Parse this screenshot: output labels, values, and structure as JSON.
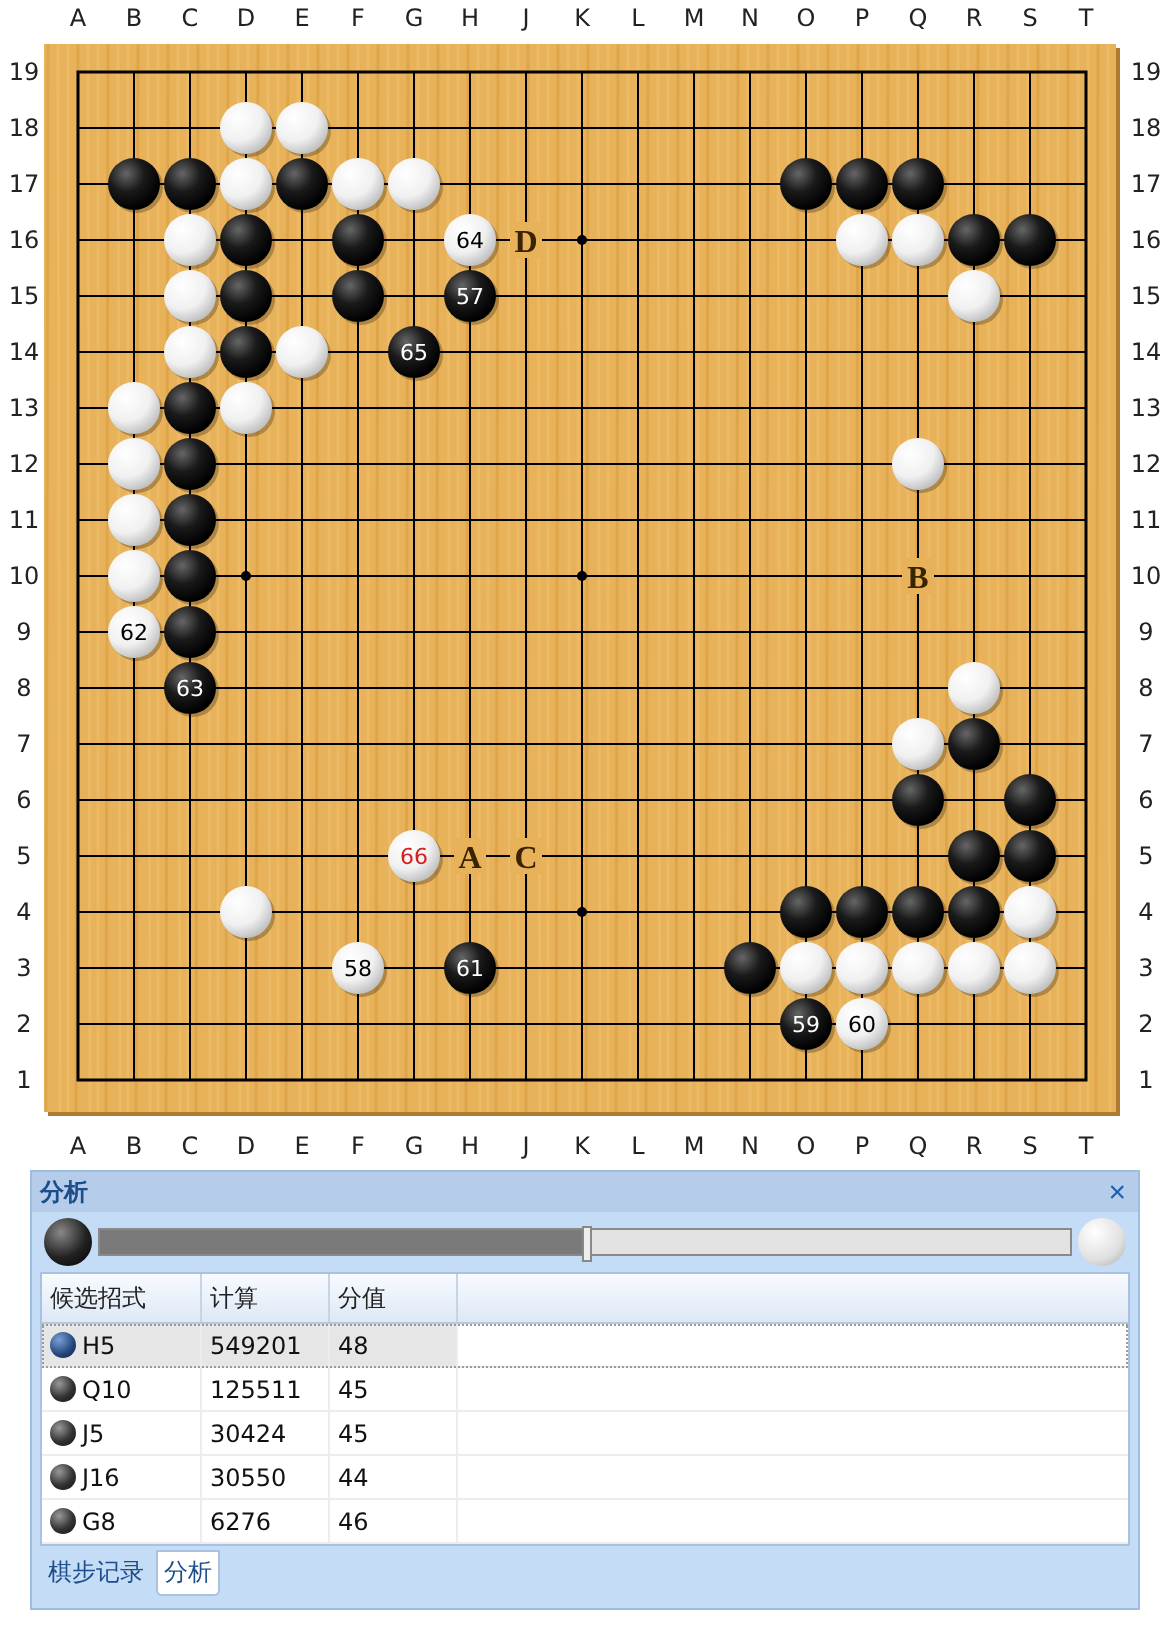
{
  "board": {
    "top_labels": [
      "A",
      "B",
      "C",
      "D",
      "E",
      "F",
      "G",
      "H",
      "J",
      "K",
      "L",
      "M",
      "N",
      "O",
      "P",
      "Q",
      "R",
      "S",
      "T"
    ],
    "bottom_labels": [
      "A",
      "B",
      "C",
      "D",
      "E",
      "F",
      "G",
      "H",
      "J",
      "K",
      "L",
      "M",
      "N",
      "O",
      "P",
      "Q",
      "R",
      "S",
      "T"
    ],
    "left_labels": [
      "19",
      "18",
      "17",
      "16",
      "15",
      "14",
      "13",
      "12",
      "11",
      "10",
      "9",
      "8",
      "7",
      "6",
      "5",
      "4",
      "3",
      "2",
      "1"
    ],
    "right_labels": [
      "19",
      "18",
      "17",
      "16",
      "15",
      "14",
      "13",
      "12",
      "11",
      "10",
      "9",
      "8",
      "7",
      "6",
      "5",
      "4",
      "3",
      "2",
      "1"
    ],
    "rows": [
      {
        "points": [
          {
            "kind": "empty"
          },
          {
            "kind": "empty"
          },
          {
            "kind": "empty"
          },
          {
            "kind": "empty"
          },
          {
            "kind": "empty"
          },
          {
            "kind": "empty"
          },
          {
            "kind": "empty"
          },
          {
            "kind": "empty"
          },
          {
            "kind": "empty"
          },
          {
            "kind": "empty"
          },
          {
            "kind": "empty"
          },
          {
            "kind": "empty"
          },
          {
            "kind": "empty"
          },
          {
            "kind": "empty"
          },
          {
            "kind": "empty"
          },
          {
            "kind": "empty"
          },
          {
            "kind": "empty"
          },
          {
            "kind": "empty"
          },
          {
            "kind": "empty"
          }
        ]
      },
      {
        "points": [
          {
            "kind": "empty"
          },
          {
            "kind": "empty"
          },
          {
            "kind": "empty"
          },
          {
            "kind": "white"
          },
          {
            "kind": "white"
          },
          {
            "kind": "empty"
          },
          {
            "kind": "empty"
          },
          {
            "kind": "empty"
          },
          {
            "kind": "empty"
          },
          {
            "kind": "empty"
          },
          {
            "kind": "empty"
          },
          {
            "kind": "empty"
          },
          {
            "kind": "empty"
          },
          {
            "kind": "empty"
          },
          {
            "kind": "empty"
          },
          {
            "kind": "empty"
          },
          {
            "kind": "empty"
          },
          {
            "kind": "empty"
          },
          {
            "kind": "empty"
          }
        ]
      },
      {
        "points": [
          {
            "kind": "empty"
          },
          {
            "kind": "black"
          },
          {
            "kind": "black"
          },
          {
            "kind": "white"
          },
          {
            "kind": "black"
          },
          {
            "kind": "white"
          },
          {
            "kind": "white"
          },
          {
            "kind": "empty"
          },
          {
            "kind": "empty"
          },
          {
            "kind": "empty"
          },
          {
            "kind": "empty"
          },
          {
            "kind": "empty"
          },
          {
            "kind": "empty"
          },
          {
            "kind": "black"
          },
          {
            "kind": "black"
          },
          {
            "kind": "black"
          },
          {
            "kind": "empty"
          },
          {
            "kind": "empty"
          },
          {
            "kind": "empty"
          }
        ]
      },
      {
        "points": [
          {
            "kind": "empty"
          },
          {
            "kind": "empty"
          },
          {
            "kind": "white"
          },
          {
            "kind": "black"
          },
          {
            "kind": "empty"
          },
          {
            "kind": "black"
          },
          {
            "kind": "empty"
          },
          {
            "kind": "white",
            "number": "64",
            "last": false
          },
          {
            "kind": "label",
            "text": "D"
          },
          {
            "kind": "star"
          },
          {
            "kind": "empty"
          },
          {
            "kind": "empty"
          },
          {
            "kind": "empty"
          },
          {
            "kind": "empty"
          },
          {
            "kind": "white"
          },
          {
            "kind": "white"
          },
          {
            "kind": "black"
          },
          {
            "kind": "black"
          },
          {
            "kind": "empty"
          }
        ]
      },
      {
        "points": [
          {
            "kind": "empty"
          },
          {
            "kind": "empty"
          },
          {
            "kind": "white"
          },
          {
            "kind": "black"
          },
          {
            "kind": "empty"
          },
          {
            "kind": "black"
          },
          {
            "kind": "empty"
          },
          {
            "kind": "black",
            "number": "57",
            "last": false
          },
          {
            "kind": "empty"
          },
          {
            "kind": "empty"
          },
          {
            "kind": "empty"
          },
          {
            "kind": "empty"
          },
          {
            "kind": "empty"
          },
          {
            "kind": "empty"
          },
          {
            "kind": "empty"
          },
          {
            "kind": "empty"
          },
          {
            "kind": "white"
          },
          {
            "kind": "empty"
          },
          {
            "kind": "empty"
          }
        ]
      },
      {
        "points": [
          {
            "kind": "empty"
          },
          {
            "kind": "empty"
          },
          {
            "kind": "white"
          },
          {
            "kind": "black"
          },
          {
            "kind": "white"
          },
          {
            "kind": "empty"
          },
          {
            "kind": "black",
            "number": "65",
            "last": false
          },
          {
            "kind": "empty"
          },
          {
            "kind": "empty"
          },
          {
            "kind": "empty"
          },
          {
            "kind": "empty"
          },
          {
            "kind": "empty"
          },
          {
            "kind": "empty"
          },
          {
            "kind": "empty"
          },
          {
            "kind": "empty"
          },
          {
            "kind": "empty"
          },
          {
            "kind": "empty"
          },
          {
            "kind": "empty"
          },
          {
            "kind": "empty"
          }
        ]
      },
      {
        "points": [
          {
            "kind": "empty"
          },
          {
            "kind": "white"
          },
          {
            "kind": "black"
          },
          {
            "kind": "white"
          },
          {
            "kind": "empty"
          },
          {
            "kind": "empty"
          },
          {
            "kind": "empty"
          },
          {
            "kind": "empty"
          },
          {
            "kind": "empty"
          },
          {
            "kind": "empty"
          },
          {
            "kind": "empty"
          },
          {
            "kind": "empty"
          },
          {
            "kind": "empty"
          },
          {
            "kind": "empty"
          },
          {
            "kind": "empty"
          },
          {
            "kind": "empty"
          },
          {
            "kind": "empty"
          },
          {
            "kind": "empty"
          },
          {
            "kind": "empty"
          }
        ]
      },
      {
        "points": [
          {
            "kind": "empty"
          },
          {
            "kind": "white"
          },
          {
            "kind": "black"
          },
          {
            "kind": "empty"
          },
          {
            "kind": "empty"
          },
          {
            "kind": "empty"
          },
          {
            "kind": "empty"
          },
          {
            "kind": "empty"
          },
          {
            "kind": "empty"
          },
          {
            "kind": "empty"
          },
          {
            "kind": "empty"
          },
          {
            "kind": "empty"
          },
          {
            "kind": "empty"
          },
          {
            "kind": "empty"
          },
          {
            "kind": "empty"
          },
          {
            "kind": "white"
          },
          {
            "kind": "empty"
          },
          {
            "kind": "empty"
          },
          {
            "kind": "empty"
          }
        ]
      },
      {
        "points": [
          {
            "kind": "empty"
          },
          {
            "kind": "white"
          },
          {
            "kind": "black"
          },
          {
            "kind": "empty"
          },
          {
            "kind": "empty"
          },
          {
            "kind": "empty"
          },
          {
            "kind": "empty"
          },
          {
            "kind": "empty"
          },
          {
            "kind": "empty"
          },
          {
            "kind": "empty"
          },
          {
            "kind": "empty"
          },
          {
            "kind": "empty"
          },
          {
            "kind": "empty"
          },
          {
            "kind": "empty"
          },
          {
            "kind": "empty"
          },
          {
            "kind": "empty"
          },
          {
            "kind": "empty"
          },
          {
            "kind": "empty"
          },
          {
            "kind": "empty"
          }
        ]
      },
      {
        "points": [
          {
            "kind": "empty"
          },
          {
            "kind": "white"
          },
          {
            "kind": "black"
          },
          {
            "kind": "star"
          },
          {
            "kind": "empty"
          },
          {
            "kind": "empty"
          },
          {
            "kind": "empty"
          },
          {
            "kind": "empty"
          },
          {
            "kind": "empty"
          },
          {
            "kind": "star"
          },
          {
            "kind": "empty"
          },
          {
            "kind": "empty"
          },
          {
            "kind": "empty"
          },
          {
            "kind": "empty"
          },
          {
            "kind": "empty"
          },
          {
            "kind": "label",
            "text": "B"
          },
          {
            "kind": "empty"
          },
          {
            "kind": "empty"
          },
          {
            "kind": "empty"
          }
        ]
      },
      {
        "points": [
          {
            "kind": "empty"
          },
          {
            "kind": "white",
            "number": "62",
            "last": false
          },
          {
            "kind": "black"
          },
          {
            "kind": "empty"
          },
          {
            "kind": "empty"
          },
          {
            "kind": "empty"
          },
          {
            "kind": "empty"
          },
          {
            "kind": "empty"
          },
          {
            "kind": "empty"
          },
          {
            "kind": "empty"
          },
          {
            "kind": "empty"
          },
          {
            "kind": "empty"
          },
          {
            "kind": "empty"
          },
          {
            "kind": "empty"
          },
          {
            "kind": "empty"
          },
          {
            "kind": "empty"
          },
          {
            "kind": "empty"
          },
          {
            "kind": "empty"
          },
          {
            "kind": "empty"
          }
        ]
      },
      {
        "points": [
          {
            "kind": "empty"
          },
          {
            "kind": "empty"
          },
          {
            "kind": "black",
            "number": "63",
            "last": false
          },
          {
            "kind": "empty"
          },
          {
            "kind": "empty"
          },
          {
            "kind": "empty"
          },
          {
            "kind": "empty"
          },
          {
            "kind": "empty"
          },
          {
            "kind": "empty"
          },
          {
            "kind": "empty"
          },
          {
            "kind": "empty"
          },
          {
            "kind": "empty"
          },
          {
            "kind": "empty"
          },
          {
            "kind": "empty"
          },
          {
            "kind": "empty"
          },
          {
            "kind": "empty"
          },
          {
            "kind": "white"
          },
          {
            "kind": "empty"
          },
          {
            "kind": "empty"
          }
        ]
      },
      {
        "points": [
          {
            "kind": "empty"
          },
          {
            "kind": "empty"
          },
          {
            "kind": "empty"
          },
          {
            "kind": "empty"
          },
          {
            "kind": "empty"
          },
          {
            "kind": "empty"
          },
          {
            "kind": "empty"
          },
          {
            "kind": "empty"
          },
          {
            "kind": "empty"
          },
          {
            "kind": "empty"
          },
          {
            "kind": "empty"
          },
          {
            "kind": "empty"
          },
          {
            "kind": "empty"
          },
          {
            "kind": "empty"
          },
          {
            "kind": "empty"
          },
          {
            "kind": "white"
          },
          {
            "kind": "black"
          },
          {
            "kind": "empty"
          },
          {
            "kind": "empty"
          }
        ]
      },
      {
        "points": [
          {
            "kind": "empty"
          },
          {
            "kind": "empty"
          },
          {
            "kind": "empty"
          },
          {
            "kind": "empty"
          },
          {
            "kind": "empty"
          },
          {
            "kind": "empty"
          },
          {
            "kind": "empty"
          },
          {
            "kind": "empty"
          },
          {
            "kind": "empty"
          },
          {
            "kind": "empty"
          },
          {
            "kind": "empty"
          },
          {
            "kind": "empty"
          },
          {
            "kind": "empty"
          },
          {
            "kind": "empty"
          },
          {
            "kind": "empty"
          },
          {
            "kind": "black"
          },
          {
            "kind": "empty"
          },
          {
            "kind": "black"
          },
          {
            "kind": "empty"
          }
        ]
      },
      {
        "points": [
          {
            "kind": "empty"
          },
          {
            "kind": "empty"
          },
          {
            "kind": "empty"
          },
          {
            "kind": "empty"
          },
          {
            "kind": "empty"
          },
          {
            "kind": "empty"
          },
          {
            "kind": "white",
            "number": "66",
            "last": true
          },
          {
            "kind": "label",
            "text": "A"
          },
          {
            "kind": "label",
            "text": "C"
          },
          {
            "kind": "empty"
          },
          {
            "kind": "empty"
          },
          {
            "kind": "empty"
          },
          {
            "kind": "empty"
          },
          {
            "kind": "empty"
          },
          {
            "kind": "empty"
          },
          {
            "kind": "empty"
          },
          {
            "kind": "black"
          },
          {
            "kind": "black"
          },
          {
            "kind": "empty"
          }
        ]
      },
      {
        "points": [
          {
            "kind": "empty"
          },
          {
            "kind": "empty"
          },
          {
            "kind": "empty"
          },
          {
            "kind": "white"
          },
          {
            "kind": "empty"
          },
          {
            "kind": "empty"
          },
          {
            "kind": "empty"
          },
          {
            "kind": "empty"
          },
          {
            "kind": "empty"
          },
          {
            "kind": "star"
          },
          {
            "kind": "empty"
          },
          {
            "kind": "empty"
          },
          {
            "kind": "empty"
          },
          {
            "kind": "black"
          },
          {
            "kind": "black"
          },
          {
            "kind": "black"
          },
          {
            "kind": "black"
          },
          {
            "kind": "white"
          },
          {
            "kind": "empty"
          }
        ]
      },
      {
        "points": [
          {
            "kind": "empty"
          },
          {
            "kind": "empty"
          },
          {
            "kind": "empty"
          },
          {
            "kind": "empty"
          },
          {
            "kind": "empty"
          },
          {
            "kind": "white",
            "number": "58",
            "last": false
          },
          {
            "kind": "empty"
          },
          {
            "kind": "black",
            "number": "61",
            "last": false
          },
          {
            "kind": "empty"
          },
          {
            "kind": "empty"
          },
          {
            "kind": "empty"
          },
          {
            "kind": "empty"
          },
          {
            "kind": "black"
          },
          {
            "kind": "white"
          },
          {
            "kind": "white"
          },
          {
            "kind": "white"
          },
          {
            "kind": "white"
          },
          {
            "kind": "white"
          },
          {
            "kind": "empty"
          }
        ]
      },
      {
        "points": [
          {
            "kind": "empty"
          },
          {
            "kind": "empty"
          },
          {
            "kind": "empty"
          },
          {
            "kind": "empty"
          },
          {
            "kind": "empty"
          },
          {
            "kind": "empty"
          },
          {
            "kind": "empty"
          },
          {
            "kind": "empty"
          },
          {
            "kind": "empty"
          },
          {
            "kind": "empty"
          },
          {
            "kind": "empty"
          },
          {
            "kind": "empty"
          },
          {
            "kind": "empty"
          },
          {
            "kind": "black",
            "number": "59",
            "last": false
          },
          {
            "kind": "white",
            "number": "60",
            "last": false
          },
          {
            "kind": "empty"
          },
          {
            "kind": "empty"
          },
          {
            "kind": "empty"
          },
          {
            "kind": "empty"
          }
        ]
      },
      {
        "points": [
          {
            "kind": "empty"
          },
          {
            "kind": "empty"
          },
          {
            "kind": "empty"
          },
          {
            "kind": "empty"
          },
          {
            "kind": "empty"
          },
          {
            "kind": "empty"
          },
          {
            "kind": "empty"
          },
          {
            "kind": "empty"
          },
          {
            "kind": "empty"
          },
          {
            "kind": "empty"
          },
          {
            "kind": "empty"
          },
          {
            "kind": "empty"
          },
          {
            "kind": "empty"
          },
          {
            "kind": "empty"
          },
          {
            "kind": "empty"
          },
          {
            "kind": "empty"
          },
          {
            "kind": "empty"
          },
          {
            "kind": "empty"
          },
          {
            "kind": "empty"
          }
        ]
      }
    ]
  },
  "panel": {
    "title": "分析",
    "close": "×",
    "slider": {
      "level": 0.5
    },
    "table": {
      "columns": [
        "候选招式",
        "计算",
        "分值"
      ],
      "rows": [
        {
          "move": "H5",
          "count": "549201",
          "score": "48",
          "selected": true
        },
        {
          "move": "Q10",
          "count": "125511",
          "score": "45",
          "selected": false
        },
        {
          "move": "J5",
          "count": "30424",
          "score": "45",
          "selected": false
        },
        {
          "move": "J16",
          "count": "30550",
          "score": "44",
          "selected": false
        },
        {
          "move": "G8",
          "count": "6276",
          "score": "46",
          "selected": false
        }
      ]
    },
    "tabs": [
      {
        "label": "棋步记录",
        "selected": false
      },
      {
        "label": "分析",
        "selected": true
      }
    ]
  }
}
